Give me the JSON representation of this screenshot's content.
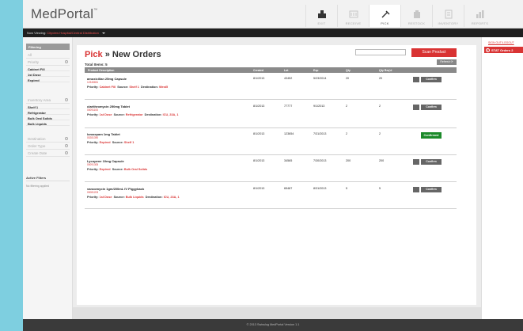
{
  "app": {
    "logo": "MedPortal",
    "logo_mark": "™"
  },
  "nav": [
    {
      "label": "EXIT",
      "icon": "exit-icon",
      "active": false
    },
    {
      "label": "RECEIVE",
      "icon": "receive-icon",
      "active": false
    },
    {
      "label": "PICK",
      "icon": "pick-icon",
      "active": true
    },
    {
      "label": "RESTOCK",
      "icon": "restock-icon",
      "active": false
    },
    {
      "label": "INVENTORY",
      "icon": "inventory-icon",
      "active": false
    },
    {
      "label": "REPORTS",
      "icon": "reports-icon",
      "active": false
    }
  ],
  "subbar": {
    "viewing_label": "Now Viewing:",
    "location": "Cityview Hospital/Central Distribution"
  },
  "sidebar": {
    "filter_header": "Filtering",
    "all": "All",
    "priority_title": "Priority",
    "priority_items": [
      "Cabinet Fill",
      "1st Dose",
      "Expired"
    ],
    "inventory_title": "Inventory Area",
    "inventory_items": [
      "Shelf 1",
      "Refrigerator",
      "Bulk Oral Solids",
      "Bulk Liquids"
    ],
    "destination_title": "Destination",
    "order_type_title": "Order Type",
    "create_date_title": "Create Date",
    "active_filters_title": "Active Filters",
    "active_filters_text": "No filtering applied"
  },
  "main": {
    "title_pick": "Pick",
    "title_sep": " » ",
    "title_rest": "New Orders",
    "total_items": "Total Items: 5",
    "scan_button": "Scan Product",
    "refresh_button": "Refresh ⟳",
    "columns": [
      "Product Description",
      "Created",
      "Lot",
      "Exp",
      "Qty",
      "Qty Req'd"
    ],
    "rows": [
      {
        "name": "amoxicillan 25mg Capsule",
        "code": "12345651",
        "priority_label": "Priority:",
        "priority": "Cabinet Fill",
        "source_label": "Source:",
        "source": "Shelf 1",
        "dest_label": "Destination:",
        "dest": "West5",
        "created": "8/1/2013",
        "lot": "43452",
        "exp": "5/23/2014",
        "qty": "20",
        "qty_req": "20",
        "action": "Confirm"
      },
      {
        "name": "clarithromycin 250mg Tablet",
        "code": "00091105",
        "priority_label": "Priority:",
        "priority": "1st Dose",
        "source_label": "Source:",
        "source": "Refrigerator",
        "dest_label": "Destination:",
        "dest": "ICU, 23A, 1",
        "created": "8/1/2013",
        "lot": "77777",
        "exp": "9/1/2013",
        "qty": "2",
        "qty_req": "2",
        "action": "Confirm"
      },
      {
        "name": "lorazepam 1mg Tablet",
        "code": "00281390",
        "priority_label": "Priority:",
        "priority": "Expired",
        "source_label": "Source:",
        "source": "Shelf 1",
        "dest_label": "",
        "dest": "",
        "created": "8/1/2013",
        "lot": "123654",
        "exp": "7/31/2013",
        "qty": "2",
        "qty_req": "2",
        "action": "Confirmed"
      },
      {
        "name": "Lycopene 10mg Capsule",
        "code": "00091305",
        "priority_label": "Priority:",
        "priority": "Expired",
        "source_label": "Source:",
        "source": "Bulk Oral Solids",
        "dest_label": "",
        "dest": "",
        "created": "8/1/2013",
        "lot": "34565",
        "exp": "7/30/2013",
        "qty": "200",
        "qty_req": "200",
        "action": "Confirm"
      },
      {
        "name": "vancomycin 1gm/200mL IV Piggyback",
        "code": "00081203",
        "priority_label": "Priority:",
        "priority": "1st Dose",
        "source_label": "Source:",
        "source": "Bulk Liquids",
        "dest_label": "Destination:",
        "dest": "ICU, 23A, 1",
        "created": "8/1/2013",
        "lot": "65487",
        "exp": "8/31/2013",
        "qty": "5",
        "qty_req": "5",
        "action": "Confirm"
      }
    ]
  },
  "right": {
    "logout": "SIGN OUT/LOGOUT",
    "stat_label": "STAT Orders",
    "stat_count": "2"
  },
  "footer": {
    "text": "© 2013 Swisslog  MedPortal Version 1.1"
  },
  "colors": {
    "accent": "#d93333",
    "confirmed": "#1c8a2a",
    "header_dark": "#1f1f1f"
  }
}
